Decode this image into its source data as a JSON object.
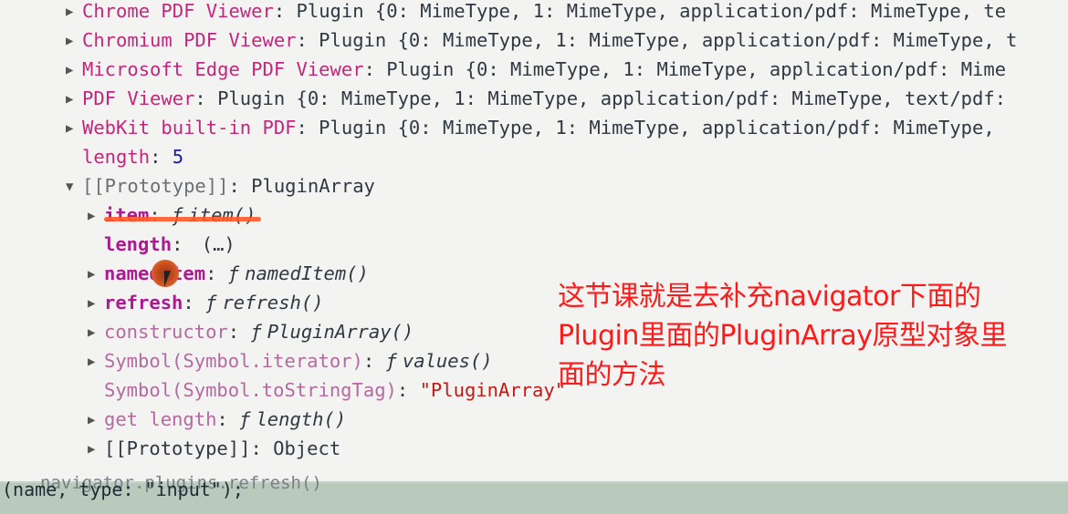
{
  "rows": [
    {
      "key": "Chrome PDF Viewer",
      "rest": ": Plugin {0: MimeType, 1: MimeType, application/pdf: MimeType, te"
    },
    {
      "key": "Chromium PDF Viewer",
      "rest": ": Plugin {0: MimeType, 1: MimeType, application/pdf: MimeType, t"
    },
    {
      "key": "Microsoft Edge PDF Viewer",
      "rest": ": Plugin {0: MimeType, 1: MimeType, application/pdf: Mime"
    },
    {
      "key": "PDF Viewer",
      "rest": ": Plugin {0: MimeType, 1: MimeType, application/pdf: MimeType, text/pdf:"
    },
    {
      "key": "WebKit built-in PDF",
      "rest": ": Plugin {0: MimeType, 1: MimeType, application/pdf: MimeType,"
    }
  ],
  "length_row": {
    "key": "length",
    "value": "5"
  },
  "prototype_row": {
    "key": "[[Prototype]]",
    "value": "PluginArray"
  },
  "proto_items": {
    "item": {
      "key": "item",
      "f": "ƒ",
      "fn": "item()"
    },
    "length": {
      "key": "length",
      "value": "(…)"
    },
    "namedItem": {
      "key": "namedItem",
      "f": "ƒ",
      "fn": "namedItem()"
    },
    "refresh": {
      "key": "refresh",
      "f": "ƒ",
      "fn": "refresh()"
    },
    "constructor": {
      "key": "constructor",
      "f": "ƒ",
      "fn": "PluginArray()"
    },
    "iterator": {
      "key": "Symbol(Symbol.iterator)",
      "f": "ƒ",
      "fn": "values()"
    },
    "toStringTag": {
      "key": "Symbol(Symbol.toStringTag)",
      "value": "\"PluginArray\""
    },
    "getLength": {
      "key": "get length",
      "f": "ƒ",
      "fn": "length()"
    },
    "objectProto": {
      "key": "[[Prototype]]",
      "value": "Object"
    }
  },
  "annotation": {
    "line1": "这节课就是去补充navigator下面的",
    "line2": "Plugin里面的PluginArray原型对象里",
    "line3": "面的方法"
  },
  "bottom": {
    "faded_input": "navigator.plugins.refresh()",
    "code": "(name, type: \"input\");"
  },
  "colors": {
    "annotation": "#ff1a1a",
    "key": "#c2267c",
    "background": "#f3f3f2",
    "bottom_strip": "#b9c9bb"
  }
}
